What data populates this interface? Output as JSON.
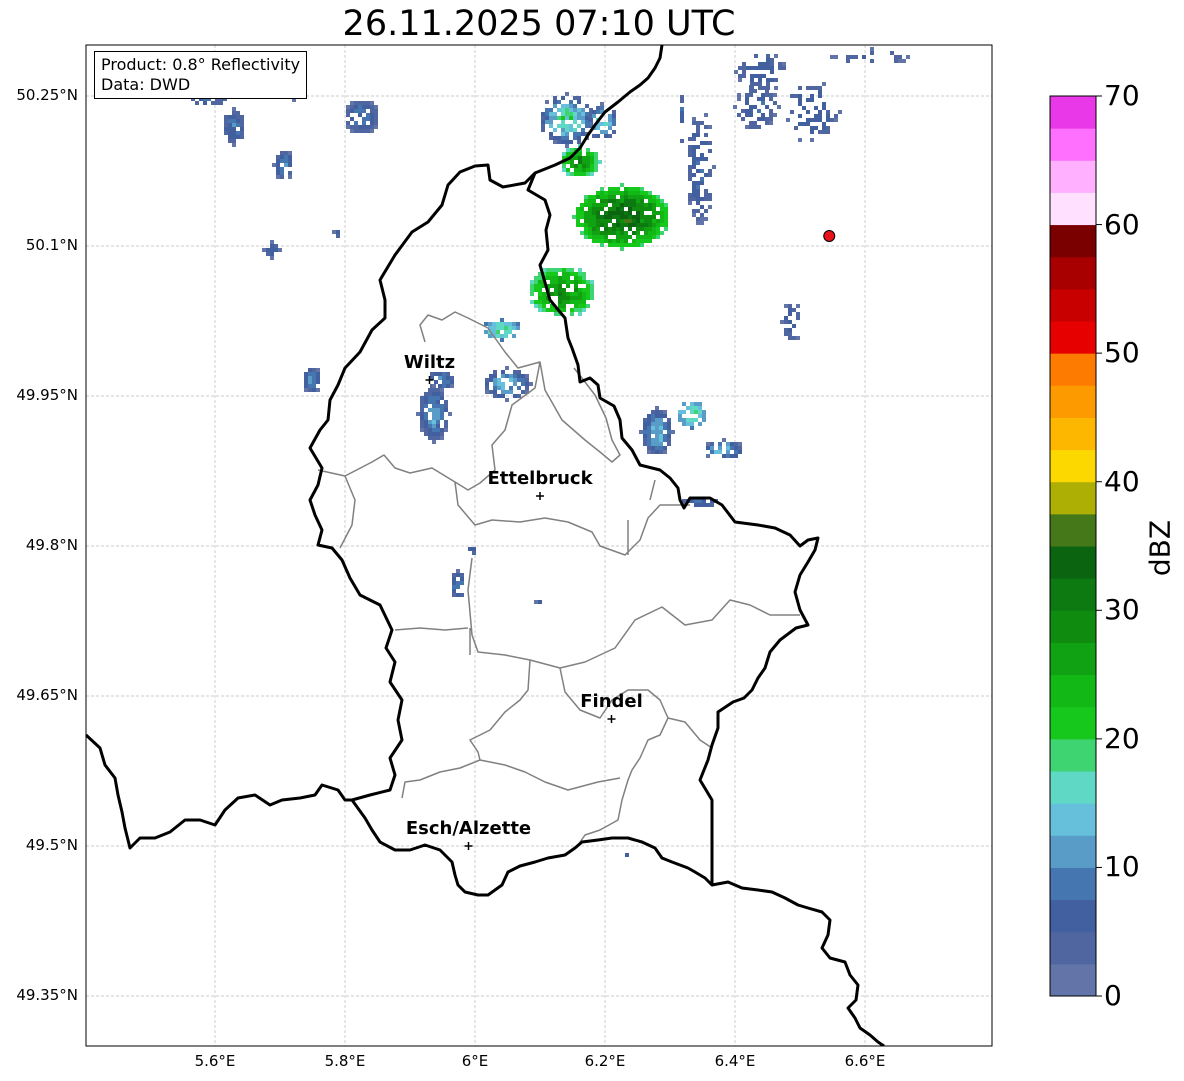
{
  "title": "26.11.2025 07:10 UTC",
  "info": {
    "product": "Product: 0.8° Reflectivity",
    "data_source": "Data: DWD"
  },
  "lat_labels": [
    "50.25°N",
    "50.1°N",
    "49.95°N",
    "49.8°N",
    "49.65°N",
    "49.5°N",
    "49.35°N"
  ],
  "lon_labels": [
    "5.6°E",
    "5.8°E",
    "6°E",
    "6.2°E",
    "6.4°E",
    "6.6°E"
  ],
  "cities": [
    {
      "name": "Wiltz",
      "lon": 5.93,
      "lat": 49.966
    },
    {
      "name": "Ettelbruck",
      "lon": 6.1,
      "lat": 49.85
    },
    {
      "name": "Findel",
      "lon": 6.21,
      "lat": 49.627
    },
    {
      "name": "Esch/Alzette",
      "lon": 5.99,
      "lat": 49.5
    }
  ],
  "marker": {
    "lon": 6.545,
    "lat": 50.11,
    "color": "#e8141a"
  },
  "colorbar": {
    "label": "dBZ",
    "tick_labels": [
      "0",
      "10",
      "20",
      "30",
      "40",
      "50",
      "60",
      "70"
    ],
    "range": [
      0,
      70
    ],
    "step": 2.5,
    "colors": [
      "#6274a8",
      "#4f66a0",
      "#4260a0",
      "#4676b0",
      "#5a9cc8",
      "#66c0dc",
      "#5fd8c6",
      "#3ed472",
      "#16c81c",
      "#12b816",
      "#10a212",
      "#0f8c0f",
      "#0c7a10",
      "#0a6410",
      "#447818",
      "#adaf05",
      "#fdd700",
      "#fdb700",
      "#fd9a00",
      "#fd7b00",
      "#e60000",
      "#c80000",
      "#a80000",
      "#7a0000",
      "#ffe0ff",
      "#ffb0ff",
      "#ff70ff",
      "#e838e8"
    ]
  },
  "map_extent": {
    "lon": [
      5.4,
      6.8
    ],
    "lat": [
      49.3,
      50.3
    ]
  },
  "colors": {
    "border": "#000000",
    "cantons": "#808080",
    "grid": "#bbbbbb"
  }
}
